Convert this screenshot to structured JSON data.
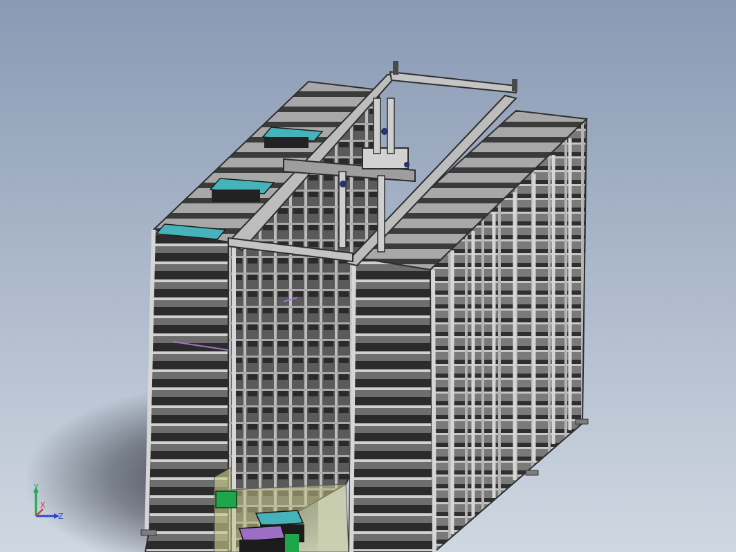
{
  "window": {
    "title": ""
  },
  "viewport": {
    "background_top": "#8a9ab4",
    "background_bottom": "#cfd7e1"
  },
  "model": {
    "frame_color": "#9a9a9a",
    "frame_dark": "#3d3d3d",
    "tray_teal": "#45b3b9",
    "tray_purple": "#9d6fc4",
    "station_green": "#1fa64a",
    "glass_tint": "#c9c98a"
  },
  "triad": {
    "y_label": "Y",
    "x_label": "X",
    "z_label": "Z",
    "y_color": "#1aa84a",
    "x_color": "#d23a3a",
    "z_color": "#2c46c8"
  }
}
